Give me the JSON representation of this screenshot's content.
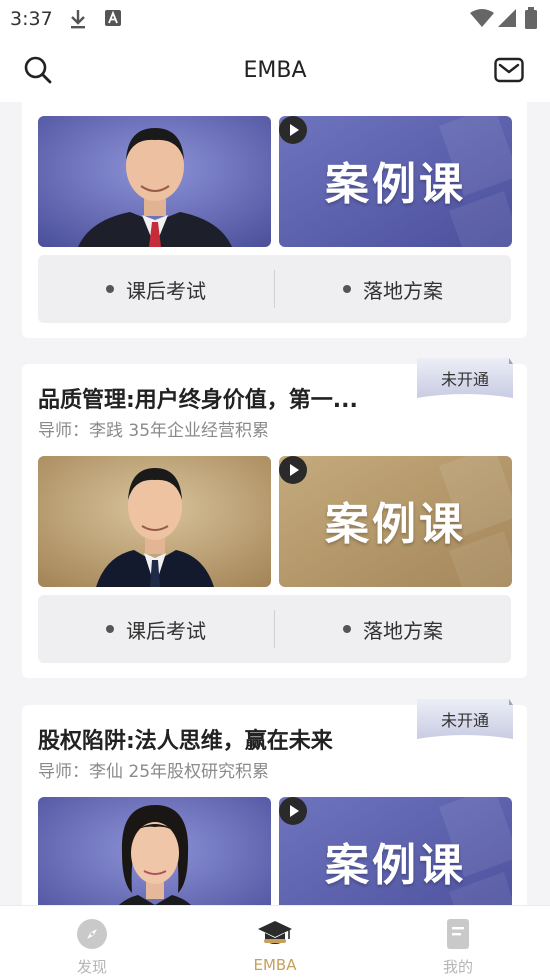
{
  "status_bar": {
    "time": "3:37"
  },
  "header": {
    "title": "EMBA"
  },
  "case_label": "案例课",
  "cards": [
    {
      "title": "",
      "subtitle": "",
      "actions": [
        "课后考试",
        "落地方案"
      ]
    },
    {
      "title": "品质管理:用户终身价值，第一...",
      "subtitle": "导师：李践 35年企业经营积累",
      "badge": "未开通",
      "actions": [
        "课后考试",
        "落地方案"
      ]
    },
    {
      "title": "股权陷阱:法人思维，赢在未来",
      "subtitle": "导师：李仙 25年股权研究积累",
      "badge": "未开通"
    }
  ],
  "tabs": [
    {
      "label": "发现",
      "icon": "compass-icon",
      "active": false
    },
    {
      "label": "EMBA",
      "icon": "graduation-cap-icon",
      "active": true
    },
    {
      "label": "我的",
      "icon": "document-icon",
      "active": false
    }
  ],
  "colors": {
    "accent": "#c6a15b",
    "thumb_blue": "#5a5ea8",
    "thumb_gold": "#b59a6e",
    "badge_bg": "#dfe1ef"
  }
}
